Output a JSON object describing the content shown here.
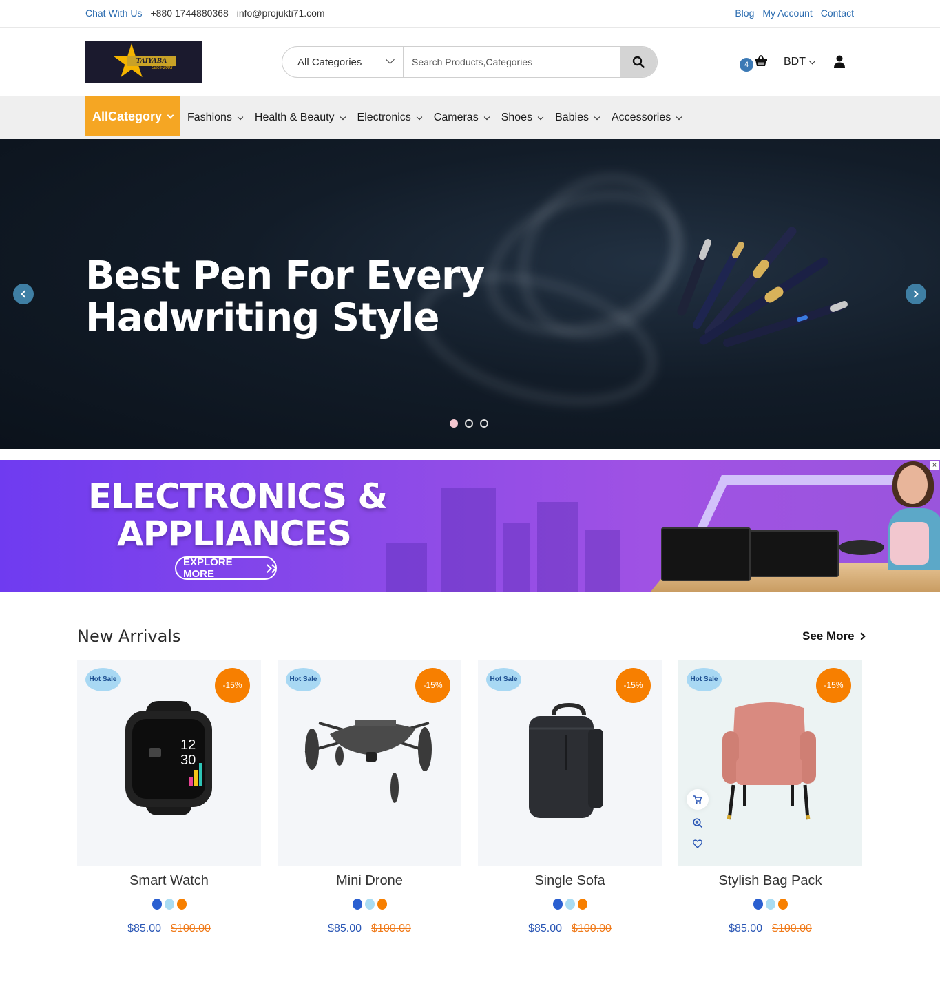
{
  "topbar": {
    "chat": "Chat With Us",
    "phone": "+880 1744880368",
    "email": "info@projukti71.com",
    "links": [
      "Blog",
      "My Account",
      "Contact"
    ]
  },
  "logo": {
    "text": "TAIYABA",
    "sub": "Since-2003"
  },
  "search": {
    "category": "All Categories",
    "placeholder": "Search Products,Categories"
  },
  "cart": {
    "count": "4"
  },
  "currency": "BDT",
  "nav": {
    "all_category": "AllCategory",
    "items": [
      "Fashions",
      "Health & Beauty",
      "Electronics",
      "Cameras",
      "Shoes",
      "Babies",
      "Accessories"
    ]
  },
  "hero": {
    "line1": "Best Pen For Every",
    "line2": "Hadwriting Style",
    "slides": 3,
    "active_slide": 1
  },
  "banner": {
    "line1": "ELECTRONICS &",
    "line2": "APPLIANCES",
    "cta": "EXPLORE MORE",
    "close": "×"
  },
  "arrivals": {
    "title": "New Arrivals",
    "see_more": "See More",
    "products": [
      {
        "name": "Smart Watch",
        "badge": "Hot Sale",
        "discount": "-15%",
        "price": "$85.00",
        "old_price": "$100.00"
      },
      {
        "name": "Mini Drone",
        "badge": "Hot Sale",
        "discount": "-15%",
        "price": "$85.00",
        "old_price": "$100.00"
      },
      {
        "name": "Single Sofa",
        "badge": "Hot Sale",
        "discount": "-15%",
        "price": "$85.00",
        "old_price": "$100.00"
      },
      {
        "name": "Stylish Bag Pack",
        "badge": "Hot Sale",
        "discount": "-15%",
        "price": "$85.00",
        "old_price": "$100.00"
      }
    ],
    "swatch_colors": [
      "#2a5fd0",
      "#a9dcf2",
      "#f77f00"
    ]
  },
  "colors": {
    "accent": "#f5a623",
    "link": "#2b6cb0",
    "price": "#2b57b5",
    "discount": "#f77f00"
  }
}
